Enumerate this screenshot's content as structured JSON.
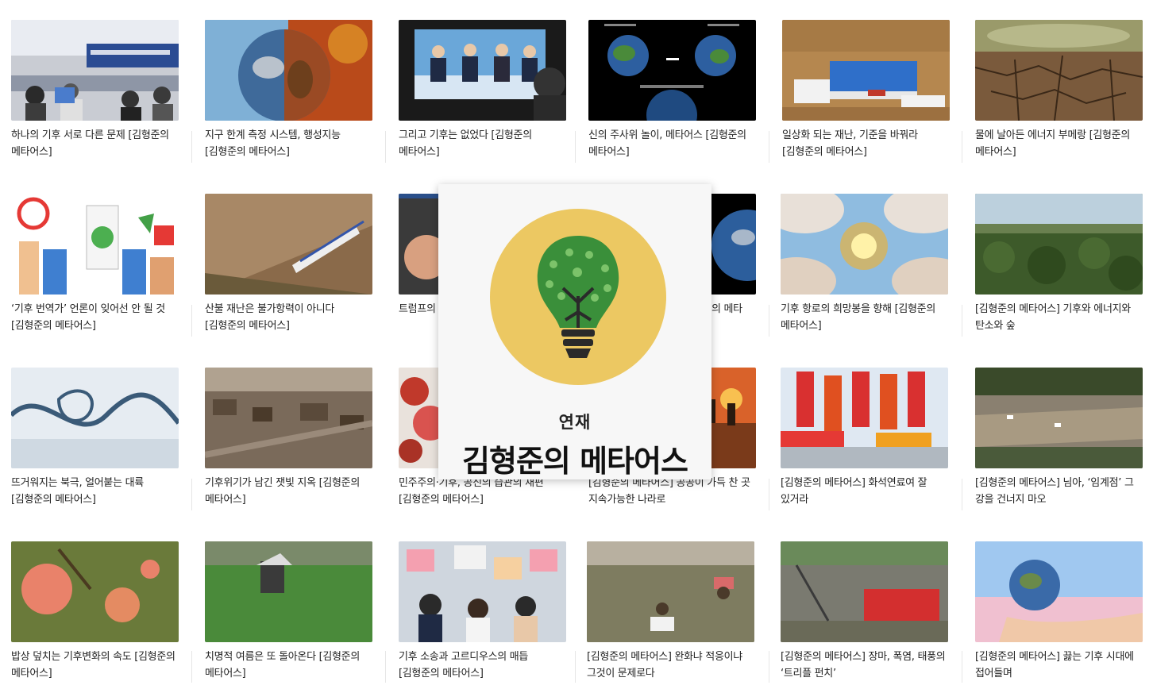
{
  "overlay": {
    "label": "연재",
    "series_name": "김형준의 메타어스",
    "icon": "lightbulb-tree-icon",
    "circle_color": "#ecc862",
    "leaf_color": "#3a8f3a"
  },
  "articles": [
    {
      "title": "하나의 기후 서로 다른 문제 [김형준의 메타어스]",
      "image": "conference-room"
    },
    {
      "title": "지구 한계 측정 시스템, 행성지능 [김형준의 메타어스]",
      "image": "earth-split-fire"
    },
    {
      "title": "그리고 기후는 없었다 [김형준의 메타어스]",
      "image": "tv-debate"
    },
    {
      "title": "신의 주사위 놀이, 메타어스 [김형준의 메타어스]",
      "image": "two-earths"
    },
    {
      "title": "일상화 되는 재난, 기준을 바꿔라 [김형준의 메타어스]",
      "image": "flood-buses"
    },
    {
      "title": "물에 날아든 에너지 부메랑 [김형준의 메타어스]",
      "image": "cracked-ground"
    },
    {
      "title": "‘기후 번역가’ 언론이 잊어선 안 될 것 [김형준의 메타어스]",
      "image": "protest-signs"
    },
    {
      "title": "산불 재난은 불가항력이 아니다 [김형준의 메타어스]",
      "image": "burnt-hill"
    },
    {
      "title": "트럼프의 [김형준의",
      "image": "portrait"
    },
    {
      "title": "의 메타",
      "image": "earth-space"
    },
    {
      "title": "기후 항로의 희망봉을 향해 [김형준의 메타어스]",
      "image": "sun-clouds"
    },
    {
      "title": "[김형준의 메타어스] 기후와 에너지와 탄소와 숲",
      "image": "forest-aerial"
    },
    {
      "title": "뜨거워지는 북극, 얼어붙는 대륙 [김형준의 메타어스]",
      "image": "frozen-river"
    },
    {
      "title": "기후위기가 남긴 잿빛 지옥 [김형준의 메타어스]",
      "image": "burnt-town"
    },
    {
      "title": "민주주의·기후, 공진의 습관의 재편 [김형준의 메타어스]",
      "image": "red-leaves"
    },
    {
      "title": "[김형준의 메타어스] 공공이 가득 찬 곳 지속가능한 나라로",
      "image": "sunset-silhouette"
    },
    {
      "title": "[김형준의 메타어스] 화석연료여 잘 있거라",
      "image": "fossil-protest"
    },
    {
      "title": "[김형준의 메타어스] 님아, ‘임계점’ 그 강을 건너지 마오",
      "image": "drought-river"
    },
    {
      "title": "밥상 덮치는 기후변화의 속도 [김형준의 메타어스]",
      "image": "peaches"
    },
    {
      "title": "치명적 여름은 또 돌아온다 [김형준의 메타어스]",
      "image": "green-field"
    },
    {
      "title": "기후 소송과 고르디우스의 매듭 [김형준의 메타어스]",
      "image": "youth-rally"
    },
    {
      "title": "[김형준의 메타어스] 완화냐 적응이냐 그것이 문제로다",
      "image": "flood-wading"
    },
    {
      "title": "[김형준의 메타어스] 장마, 폭염, 태풍의 ‘트리플 펀치’",
      "image": "flooded-street"
    },
    {
      "title": "[김형준의 메타어스] 끓는 기후 시대에 접어들며",
      "image": "earth-hand"
    }
  ]
}
